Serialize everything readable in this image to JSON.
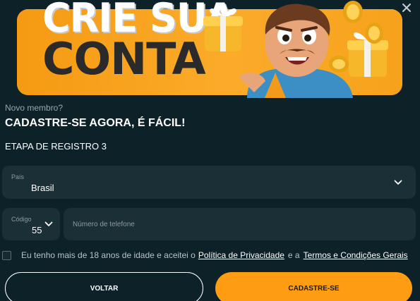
{
  "banner": {
    "line1": "CRIE SUA",
    "line2": "CONTA"
  },
  "intro": {
    "subtitle": "Novo membro?",
    "headline": "CADASTRE-SE AGORA, É FÁCIL!",
    "step": "ETAPA DE REGISTRO 3"
  },
  "country": {
    "label": "País",
    "value": "Brasil"
  },
  "code": {
    "label": "Código",
    "value": "55"
  },
  "phone": {
    "placeholder": "Número de telefone"
  },
  "terms": {
    "prefix": "Eu tenho mais de 18 anos de idade e aceitei o",
    "privacy_link": "Política de Privacidade",
    "connector": "e a",
    "terms_link": "Termos e Condições Gerais"
  },
  "buttons": {
    "back": "VOLTAR",
    "submit": "CADASTRE-SE"
  },
  "colors": {
    "background": "#0d2128",
    "field": "#1b2f36",
    "accent": "#ff9d12",
    "banner": "#f7a21c"
  },
  "icons": {
    "close": "close-icon",
    "chevron": "chevron-down-icon"
  }
}
